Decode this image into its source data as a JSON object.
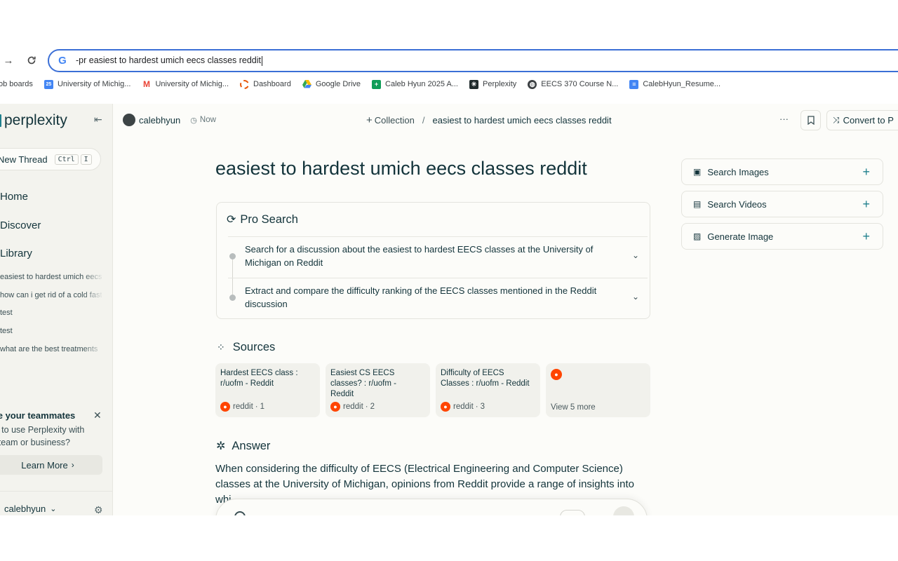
{
  "browser": {
    "omnibox_text": "-pr easiest to hardest umich eecs classes reddit",
    "bookmarks": [
      {
        "label": "ob boards",
        "icon": "folder-icon"
      },
      {
        "label": "University of Michig...",
        "icon": "calendar-icon"
      },
      {
        "label": "University of Michig...",
        "icon": "gmail-icon"
      },
      {
        "label": "Dashboard",
        "icon": "dashboard-icon"
      },
      {
        "label": "Google Drive",
        "icon": "drive-icon"
      },
      {
        "label": "Caleb Hyun 2025 A...",
        "icon": "sheets-icon"
      },
      {
        "label": "Perplexity",
        "icon": "perplexity-icon"
      },
      {
        "label": "EECS 370 Course N...",
        "icon": "globe-icon"
      },
      {
        "label": "CalebHyun_Resume...",
        "icon": "docs-icon"
      }
    ]
  },
  "sidebar": {
    "logo": "perplexity",
    "new_thread": "New Thread",
    "shortcut_ctrl": "Ctrl",
    "shortcut_key": "I",
    "nav": [
      "Home",
      "Discover",
      "Library"
    ],
    "threads": [
      "easiest to hardest umich eecs",
      "how can i get rid of a cold fast",
      "test",
      "test",
      "what are the best treatments"
    ],
    "promo_title": "Invite your teammates",
    "promo_body_1": "Want to use Perplexity with",
    "promo_body_2": "your team or business?",
    "learn_more": "Learn More",
    "username": "calebhyun"
  },
  "header": {
    "user": "calebhyun",
    "time": "Now",
    "collection": "Collection",
    "separator": "/",
    "thread_title": "easiest to hardest umich eecs classes reddit",
    "more": "···",
    "convert": "Convert to P"
  },
  "main": {
    "title": "easiest to hardest umich eecs classes reddit",
    "pro_search": {
      "label": "Pro Search",
      "steps": [
        {
          "line1": "Search for a discussion about the easiest to hardest EECS classes at the University of",
          "line2": "Michigan on Reddit"
        },
        {
          "line1": "Extract and compare the difficulty ranking of the EECS classes mentioned in the Reddit",
          "line2": "discussion"
        }
      ]
    },
    "sources_label": "Sources",
    "sources": [
      {
        "line1": "Hardest EECS class :",
        "line2": "r/uofm - Reddit",
        "line3": "",
        "site": "reddit",
        "num": "1"
      },
      {
        "line1": "Easiest CS EECS",
        "line2": "classes? : r/uofm -",
        "line3": "Reddit",
        "site": "reddit",
        "num": "2"
      },
      {
        "line1": "Difficulty of EECS",
        "line2": "Classes : r/uofm - Reddit",
        "line3": "",
        "site": "reddit",
        "num": "3"
      }
    ],
    "view_more": "View 5 more",
    "answer_label": "Answer",
    "answer_line1": "When considering the difficulty of EECS (Electrical Engineering and Computer Science)",
    "answer_line2": "classes at the University of Michigan, opinions from Reddit provide a range of insights into",
    "answer_line3": "whi"
  },
  "right_panel": {
    "buttons": [
      "Search Images",
      "Search Videos",
      "Generate Image"
    ]
  },
  "colors": {
    "accent": "#20808d",
    "reddit": "#ff4500",
    "omnibox_border": "#3b6fd6"
  }
}
